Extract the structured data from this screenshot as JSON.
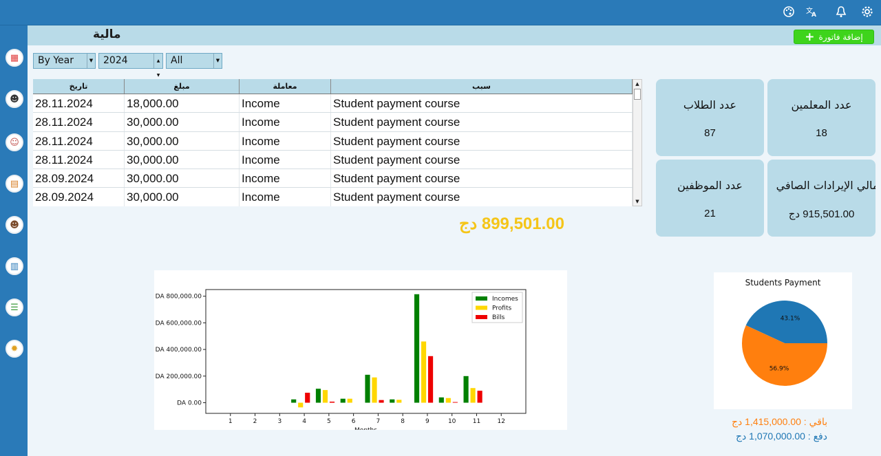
{
  "header": {
    "icons": [
      "palette-icon",
      "translate-icon",
      "bell-icon",
      "gear-icon"
    ]
  },
  "sidebar": {
    "items": [
      {
        "icon": "calendar-icon"
      },
      {
        "icon": "teacher-icon"
      },
      {
        "icon": "students-icon"
      },
      {
        "icon": "certificate-icon"
      },
      {
        "icon": "staff-icon"
      },
      {
        "icon": "reports-icon"
      },
      {
        "icon": "list-icon"
      },
      {
        "icon": "settings-icon"
      }
    ]
  },
  "page": {
    "title": "مالية",
    "add_invoice_label": "إضافة فاتورة"
  },
  "filters": {
    "period": "By Year",
    "year": "2024",
    "type": "All"
  },
  "table": {
    "headers": [
      "تاريخ",
      "مبلغ",
      "معاملة",
      "سبب"
    ],
    "rows": [
      [
        "28.11.2024",
        "18,000.00",
        "Income",
        "Student payment course"
      ],
      [
        "28.11.2024",
        "30,000.00",
        "Income",
        "Student payment course"
      ],
      [
        "28.11.2024",
        "30,000.00",
        "Income",
        "Student payment course"
      ],
      [
        "28.11.2024",
        "30,000.00",
        "Income",
        "Student payment course"
      ],
      [
        "28.09.2024",
        "30,000.00",
        "Income",
        "Student payment course"
      ],
      [
        "28.09.2024",
        "30,000.00",
        "Income",
        "Student payment course"
      ]
    ]
  },
  "total": "899,501.00 دج",
  "stats": {
    "students_label": "عدد الطلاب",
    "students_value": "87",
    "teachers_label": "عدد المعلمين",
    "teachers_value": "18",
    "employees_label": "عدد الموظفين",
    "employees_value": "21",
    "net_income_label": "جمالي الإيرادات الصافي",
    "net_income_value": "915,501.00 دج"
  },
  "colors": {
    "incomes": "#008000",
    "profits": "#ffd700",
    "bills": "#ee0000",
    "pie_blue": "#1f77b4",
    "pie_orange": "#ff7f0e",
    "accent_green": "#3ed41c",
    "total_yellow": "#f5c518"
  },
  "chart_data": [
    {
      "type": "bar",
      "title": "",
      "xlabel": "Months",
      "ylabel": "",
      "categories": [
        "1",
        "2",
        "3",
        "4",
        "5",
        "6",
        "7",
        "8",
        "9",
        "10",
        "11",
        "12"
      ],
      "series": [
        {
          "name": "Incomes",
          "values": [
            0,
            0,
            0,
            25000,
            105000,
            30000,
            210000,
            25000,
            815000,
            40000,
            200000,
            0
          ]
        },
        {
          "name": "Profits",
          "values": [
            0,
            0,
            0,
            -35000,
            95000,
            30000,
            190000,
            22000,
            460000,
            35000,
            110000,
            0
          ]
        },
        {
          "name": "Bills",
          "values": [
            0,
            0,
            0,
            75000,
            8000,
            0,
            20000,
            0,
            350000,
            5000,
            90000,
            0
          ]
        }
      ],
      "yticks": [
        "DA 0.00",
        "DA 200,000.00",
        "DA 400,000.00",
        "DA 600,000.00",
        "DA 800,000.00"
      ],
      "ylim": [
        -80000,
        850000
      ],
      "legend": "top-right"
    },
    {
      "type": "pie",
      "title": "Students Payment",
      "slices": [
        {
          "value": 43.1,
          "label": "43.1%"
        },
        {
          "value": 56.9,
          "label": "56.9%"
        }
      ]
    }
  ],
  "payments": {
    "remaining": "باقي : 1,415,000.00 دج",
    "paid": "دفع : 1,070,000.00 دج"
  }
}
